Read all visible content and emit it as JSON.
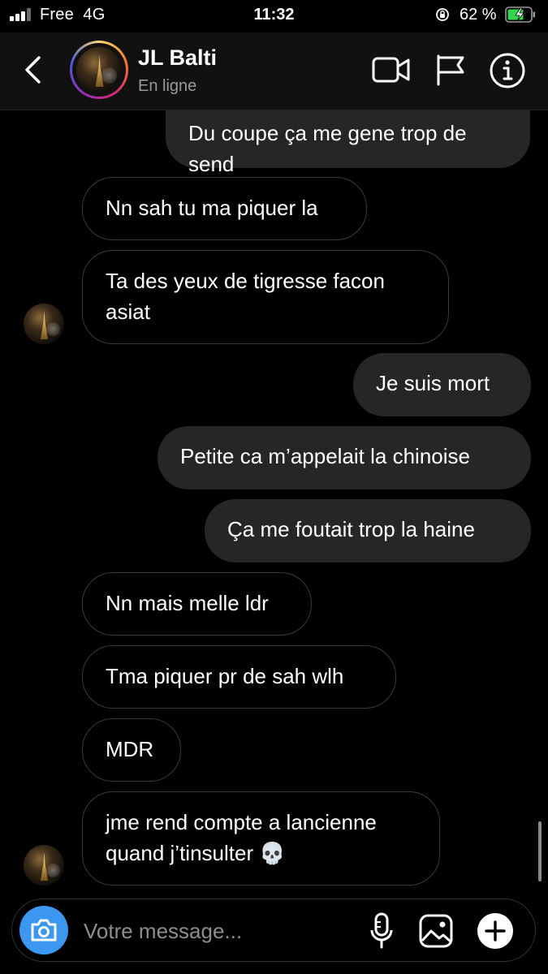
{
  "status_bar": {
    "carrier": "Free  4G",
    "time": "11:32",
    "battery_percent": "62 %"
  },
  "header": {
    "contact_name": "JL Balti",
    "contact_status": "En ligne"
  },
  "messages": [
    {
      "direction": "out",
      "lines": [
        "Du coupe ça me gene trop de",
        "send"
      ]
    },
    {
      "direction": "in",
      "lines": [
        "Nn sah tu ma piquer la"
      ]
    },
    {
      "direction": "in",
      "lines": [
        "Ta des yeux de tigresse facon",
        "asiat"
      ]
    },
    {
      "direction": "out",
      "lines": [
        "Je suis mort"
      ]
    },
    {
      "direction": "out",
      "lines": [
        "Petite ca m’appelait la chinoise"
      ]
    },
    {
      "direction": "out",
      "lines": [
        "Ça me foutait trop la haine"
      ]
    },
    {
      "direction": "in",
      "lines": [
        "Nn mais melle ldr"
      ]
    },
    {
      "direction": "in",
      "lines": [
        "Tma piquer pr de sah wlh"
      ]
    },
    {
      "direction": "in",
      "lines": [
        "MDR"
      ]
    },
    {
      "direction": "in",
      "lines": [
        "jme rend compte a lancienne",
        "quand j’tinsulter 💀"
      ]
    }
  ],
  "composer": {
    "placeholder": "Votre message..."
  },
  "icons": {
    "back": "chevron-left-icon",
    "video": "video-camera-icon",
    "flag": "flag-icon",
    "info": "info-icon",
    "camera": "camera-icon",
    "mic": "microphone-icon",
    "gallery": "gallery-icon",
    "plus": "plus-icon"
  },
  "colors": {
    "background": "#000000",
    "outgoing_bubble": "#262626",
    "incoming_border": "#3a3a3a",
    "camera_button": "#3b97f0",
    "battery_fill": "#32d74b"
  }
}
